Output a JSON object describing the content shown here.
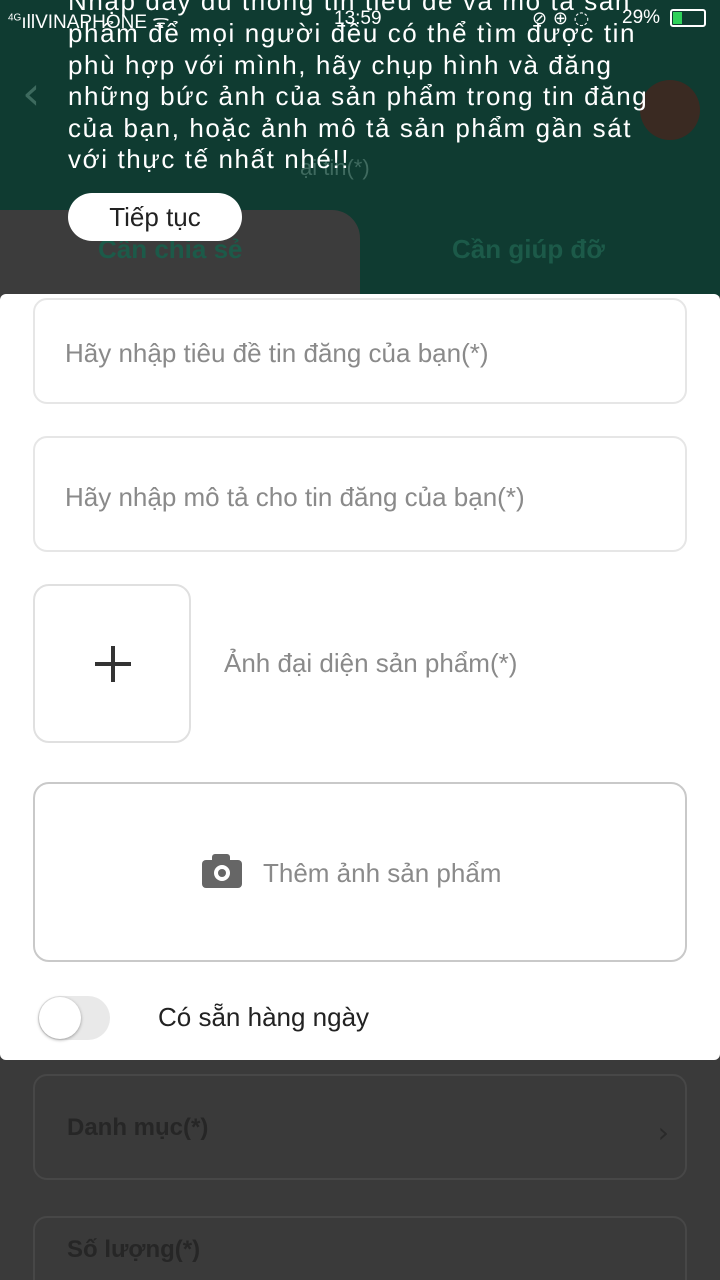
{
  "status_bar": {
    "network": "4G",
    "carrier": "VINAPHONE",
    "time": "13:59",
    "battery": "29%",
    "battery_level": 0.29,
    "icons": [
      "signal-icon",
      "wifi-icon",
      "mute-icon",
      "lock-icon",
      "location-icon",
      "battery-icon"
    ]
  },
  "background": {
    "back_icon": "‹",
    "header_sub_fragment": "ại tin(*)",
    "tabs": [
      "Cần chia sẻ",
      "Cần giúp đỡ"
    ],
    "fields": [
      {
        "label": "Danh mục(*)",
        "chevron": "›"
      },
      {
        "label": "Số lượng(*)"
      }
    ]
  },
  "tip": {
    "lines": [
      "Nhập đầy đủ thông tin tiêu đề và mô tả sản",
      "phẩm để mọi người đều có thể tìm được tin",
      "phù hợp với mình, hãy chụp hình và đăng",
      "những bức ảnh của sản phẩm trong tin đăng",
      "của bạn, hoặc ảnh mô tả sản phẩm gần sát",
      "với thực tế nhất nhé!!"
    ],
    "continue_label": "Tiếp tục"
  },
  "form": {
    "title_placeholder": "Hãy nhập tiêu đề tin đăng của bạn(*)",
    "description_placeholder": "Hãy nhập mô tả cho tin đăng của bạn(*)",
    "cover_image_label": "Ảnh đại diện sản phẩm(*)",
    "add_photos_label": "Thêm ảnh sản phẩm",
    "daily_available_label": "Có sẵn hàng ngày",
    "daily_available_on": false
  },
  "colors": {
    "header_green": "#0f3b31",
    "battery_green": "#2fd15a"
  }
}
